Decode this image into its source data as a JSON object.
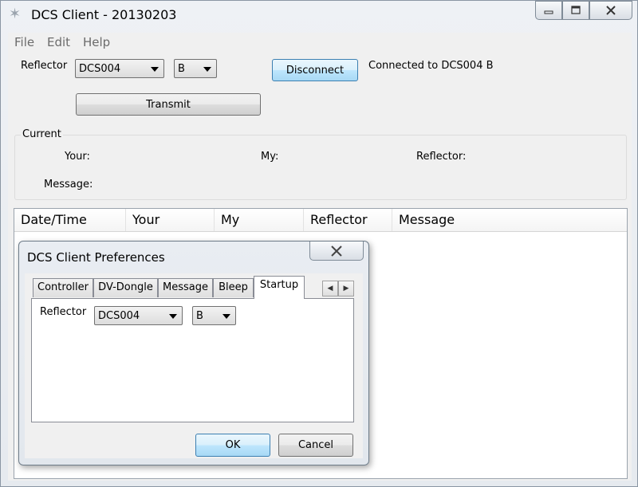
{
  "window": {
    "title": "DCS Client - 20130203"
  },
  "menu": {
    "items": [
      "File",
      "Edit",
      "Help"
    ]
  },
  "top": {
    "reflector_label": "Reflector",
    "reflector_value": "DCS004",
    "module_value": "B",
    "disconnect_label": "Disconnect",
    "status_text": "Connected to DCS004 B",
    "transmit_label": "Transmit"
  },
  "current": {
    "title": "Current",
    "your_label": "Your:",
    "my_label": "My:",
    "reflector_label": "Reflector:",
    "message_label": "Message:"
  },
  "log": {
    "columns": [
      "Date/Time",
      "Your",
      "My",
      "Reflector",
      "Message"
    ]
  },
  "dialog": {
    "title": "DCS Client Preferences",
    "tabs": [
      "Controller",
      "DV-Dongle",
      "Message",
      "Bleep",
      "Startup"
    ],
    "active_tab": "Startup",
    "reflector_label": "Reflector",
    "reflector_value": "DCS004",
    "module_value": "B",
    "ok_label": "OK",
    "cancel_label": "Cancel"
  }
}
